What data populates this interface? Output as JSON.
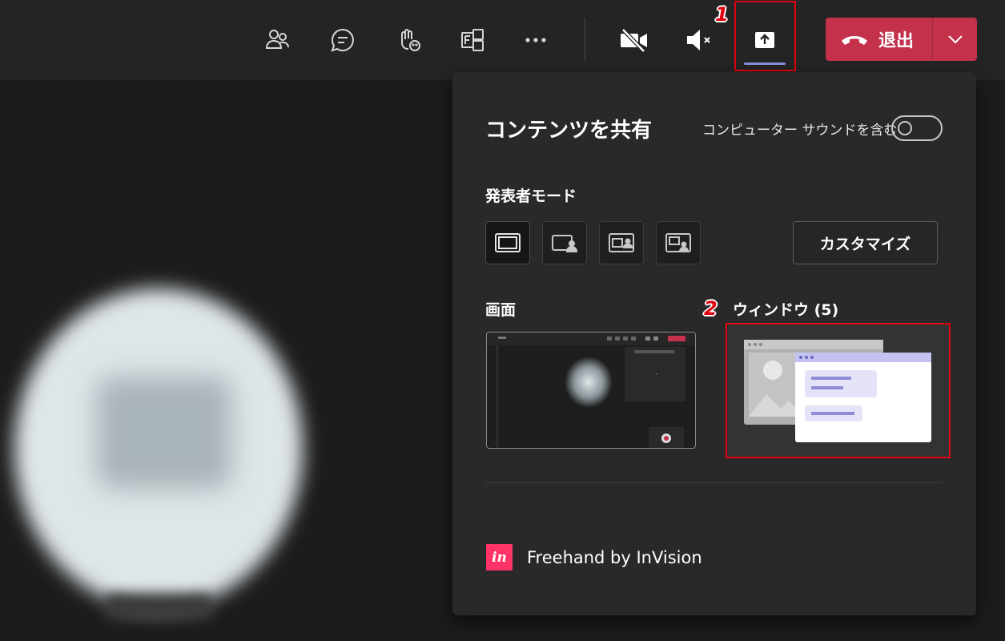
{
  "meeting_toolbar": {
    "buttons": [
      {
        "icon": "participants-icon"
      },
      {
        "icon": "chat-icon"
      },
      {
        "icon": "raise-hand-icon"
      },
      {
        "icon": "apps-icon"
      },
      {
        "icon": "more-options-icon"
      },
      {
        "icon": "camera-off-icon"
      },
      {
        "icon": "mic-muted-icon"
      },
      {
        "icon": "share-content-icon"
      }
    ],
    "leave_label": "退出",
    "leave_color": "#c4314b"
  },
  "annotations": {
    "step1": "1",
    "step2": "2",
    "highlight_color": "#e0000f"
  },
  "share_panel": {
    "title": "コンテンツを共有",
    "include_sound_label": "コンピューター サウンドを含む",
    "include_sound_on": false,
    "presenter_mode_label": "発表者モード",
    "presenter_modes": [
      "content-only-icon",
      "standout-icon",
      "side-by-side-icon",
      "reporter-icon"
    ],
    "customize_label": "カスタマイズ",
    "screen_label": "画面",
    "window_label": "ウィンドウ (5)",
    "app_name": "Freehand by InVision",
    "app_icon_text": "in",
    "app_icon_color": "#ff3366"
  }
}
